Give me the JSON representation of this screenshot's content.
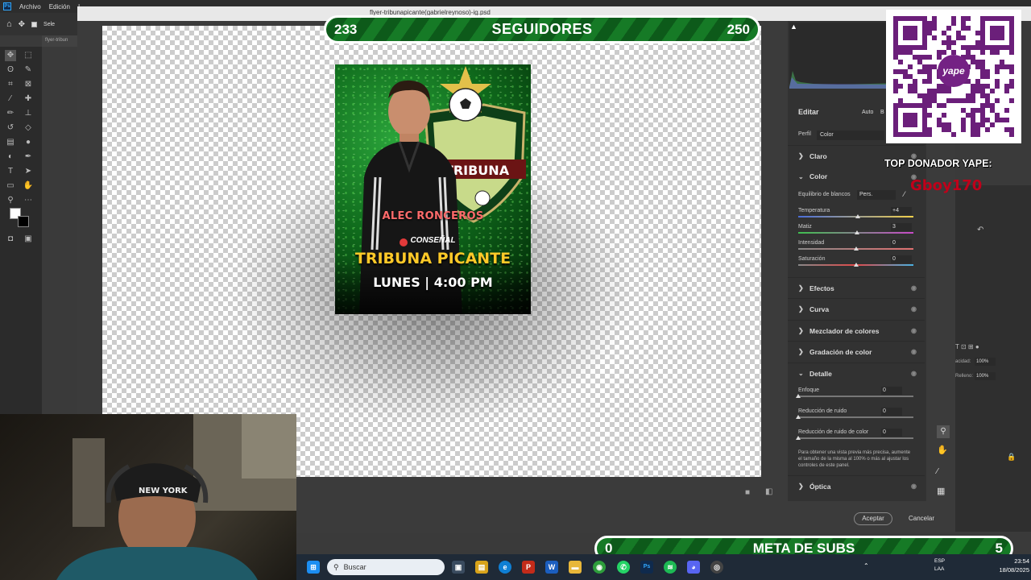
{
  "menubar": {
    "app_logo": "Ps",
    "items": [
      "Archivo",
      "Edición",
      "I"
    ]
  },
  "options": {
    "select_label": "Sele"
  },
  "doc_tab": "flyer-tribun",
  "acr": {
    "window_title": "flyer-tribunapicante(gabrielreynoso)-ig.psd",
    "panel": {
      "edit_label": "Editar",
      "auto_label": "Auto",
      "bw_label": "B",
      "profile_label": "Perfil",
      "profile_value": "Color",
      "sections": {
        "claro": "Claro",
        "color": "Color",
        "efectos": "Efectos",
        "curva": "Curva",
        "mezclador": "Mezclador de colores",
        "gradacion": "Gradación de color",
        "detalle": "Detalle",
        "optica": "Óptica"
      },
      "white_balance_label": "Equilibrio de blancos",
      "white_balance_value": "Pers.",
      "sliders_color": [
        {
          "label": "Temperatura",
          "value": "+4",
          "level": 0.52
        },
        {
          "label": "Matiz",
          "value": "3",
          "level": 0.51
        },
        {
          "label": "Intensidad",
          "value": "0",
          "level": 0.5
        },
        {
          "label": "Saturación",
          "value": "0",
          "level": 0.5
        }
      ],
      "sliders_detail": [
        {
          "label": "Enfoque",
          "value": "0",
          "level": 0.0
        },
        {
          "label": "Reducción de ruido",
          "value": "0",
          "level": 0.0
        },
        {
          "label": "Reducción de ruido de color",
          "value": "0",
          "level": 0.0
        }
      ],
      "detail_note": "Para obtener una vista previa más precisa, aumente el tamaño de la misma al 100% o más al ajustar los controles de este panel."
    },
    "buttons": {
      "accept": "Aceptar",
      "cancel": "Cancelar"
    }
  },
  "flyer": {
    "name": "ALEC RONCEROS",
    "badge_text": "TRIBUNA",
    "brand": "CONSEÑAL",
    "title": "TRIBUNA PICANTE",
    "time": "LUNES | 4:00 PM"
  },
  "overlay": {
    "followers_current": "233",
    "followers_label": "SEGUIDORES",
    "followers_goal": "250",
    "subs_current": "0",
    "subs_label": "META DE SUBS",
    "subs_goal": "5",
    "yape_logo": "yape",
    "top_donor_label": "TOP DONADOR YAPE:",
    "top_donor_name": "Gboy170"
  },
  "ps_right": {
    "opacity_label": "acidad:",
    "opacity_value": "100%",
    "fill_label": "Relleno:",
    "fill_value": "100%"
  },
  "taskbar": {
    "search_placeholder": "Buscar",
    "lang": "ESP",
    "lang2": "LAA",
    "time": "23:54",
    "date": "18/08/2025"
  },
  "colors": {
    "accent_green": "#167a26",
    "donor_red": "#c0001a",
    "flyer_gold": "#ffc928"
  }
}
